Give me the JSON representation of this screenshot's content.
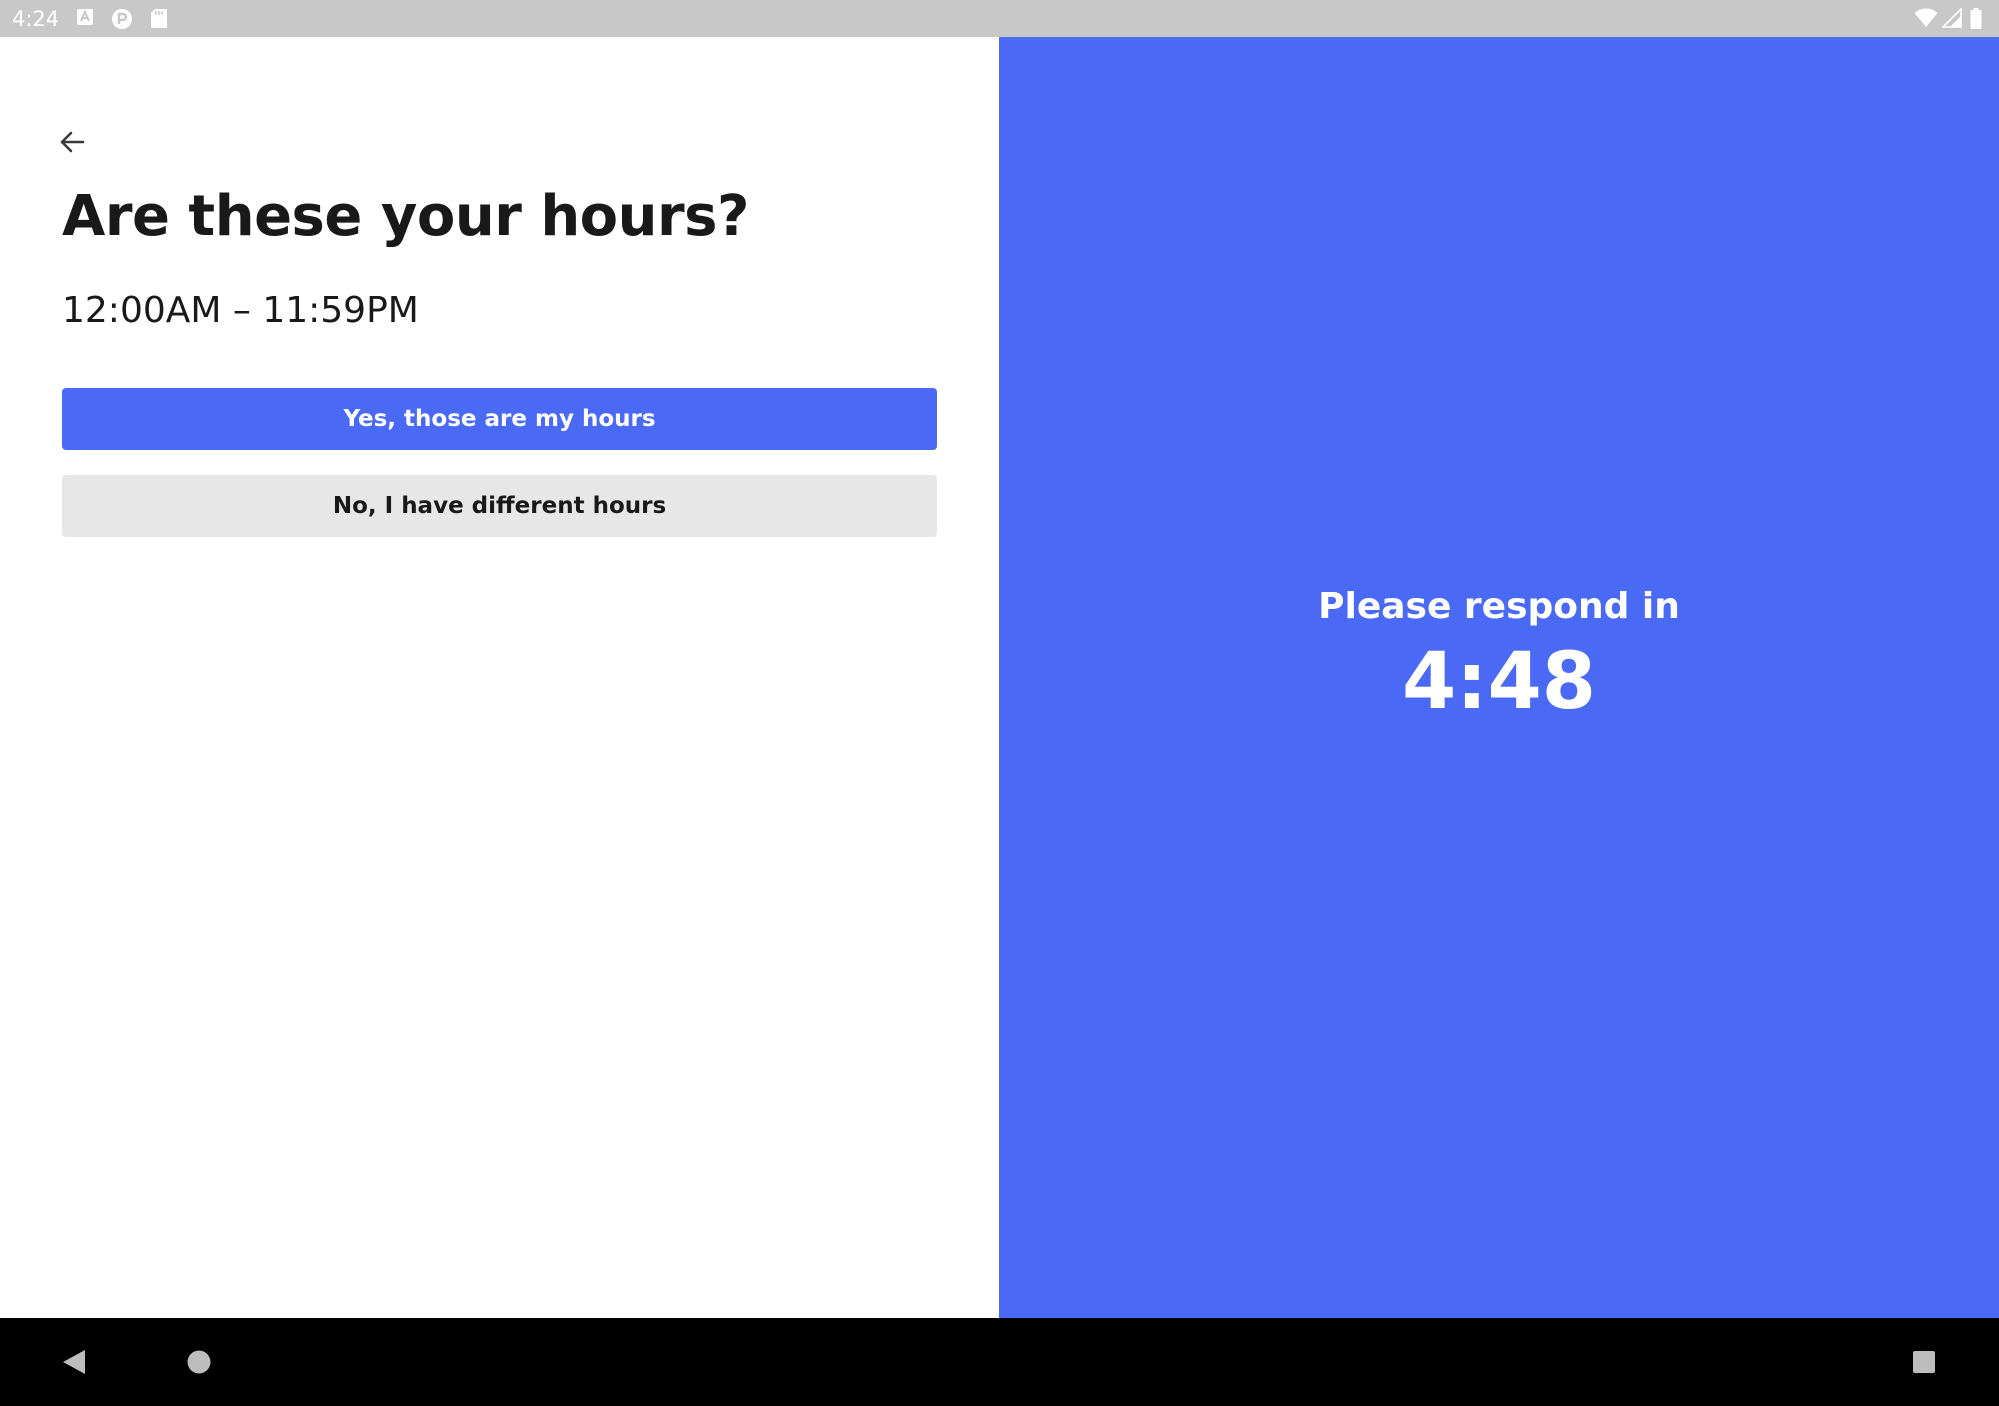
{
  "status_bar": {
    "time": "4:24",
    "left_icons": [
      "a-notification-icon",
      "p-notification-icon",
      "sd-card-icon"
    ],
    "right_icons": [
      "wifi-icon",
      "signal-icon",
      "battery-icon"
    ],
    "background": "#c8c8c8"
  },
  "left_panel": {
    "back_icon": "arrow-left-icon",
    "title": "Are these your hours?",
    "hours": "12:00AM – 11:59PM",
    "yes_button_label": "Yes, those are my hours",
    "no_button_label": "No, I have different hours"
  },
  "right_panel": {
    "respond_label": "Please respond in",
    "countdown": "4:48",
    "background": "#4a69f4"
  },
  "nav_bar": {
    "icons": [
      "nav-back-icon",
      "nav-home-icon",
      "nav-recents-icon"
    ]
  },
  "colors": {
    "accent": "#4a69f4",
    "secondary_button": "#e7e7e7",
    "text_primary": "#191919"
  }
}
